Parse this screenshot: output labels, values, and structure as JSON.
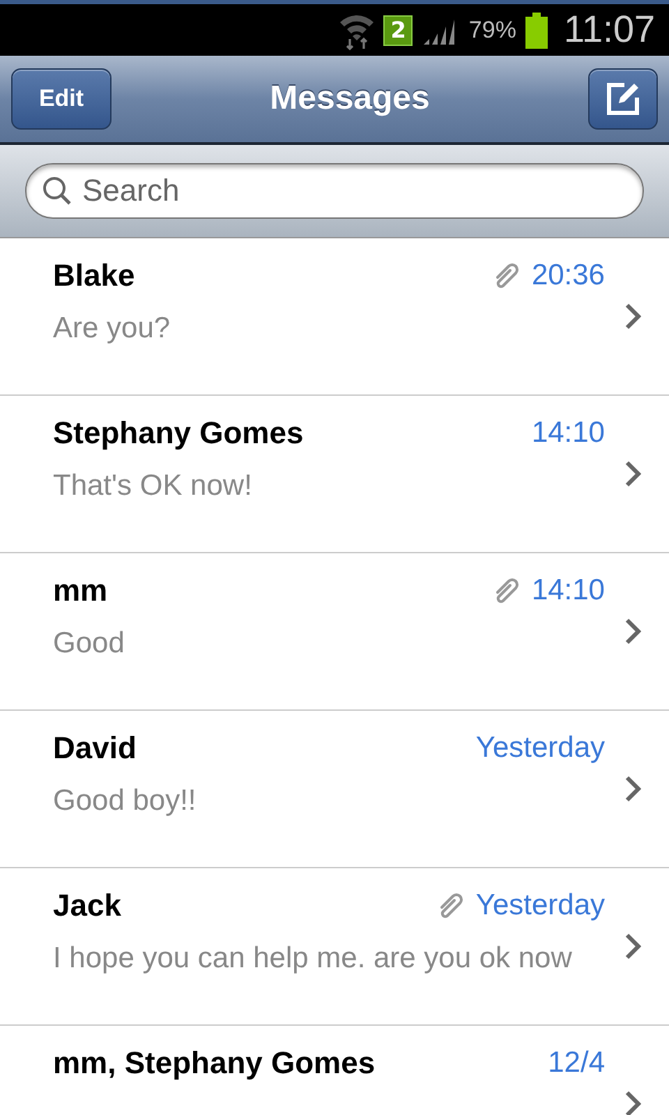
{
  "status_bar": {
    "sim": "2",
    "battery": "79%",
    "time": "11:07"
  },
  "header": {
    "edit": "Edit",
    "title": "Messages"
  },
  "search": {
    "placeholder": "Search"
  },
  "conversations": [
    {
      "name": "Blake",
      "time": "20:36",
      "attachment": true,
      "preview": "Are you?"
    },
    {
      "name": "Stephany Gomes",
      "time": "14:10",
      "attachment": false,
      "preview": "That's OK now!"
    },
    {
      "name": "mm",
      "time": "14:10",
      "attachment": true,
      "preview": "Good"
    },
    {
      "name": "David",
      "time": "Yesterday",
      "attachment": false,
      "preview": "Good boy!!"
    },
    {
      "name": "Jack",
      "time": "Yesterday",
      "attachment": true,
      "preview": "I hope you can help me. are you ok now"
    },
    {
      "name": "mm, Stephany Gomes",
      "time": "12/4",
      "attachment": false
    }
  ]
}
